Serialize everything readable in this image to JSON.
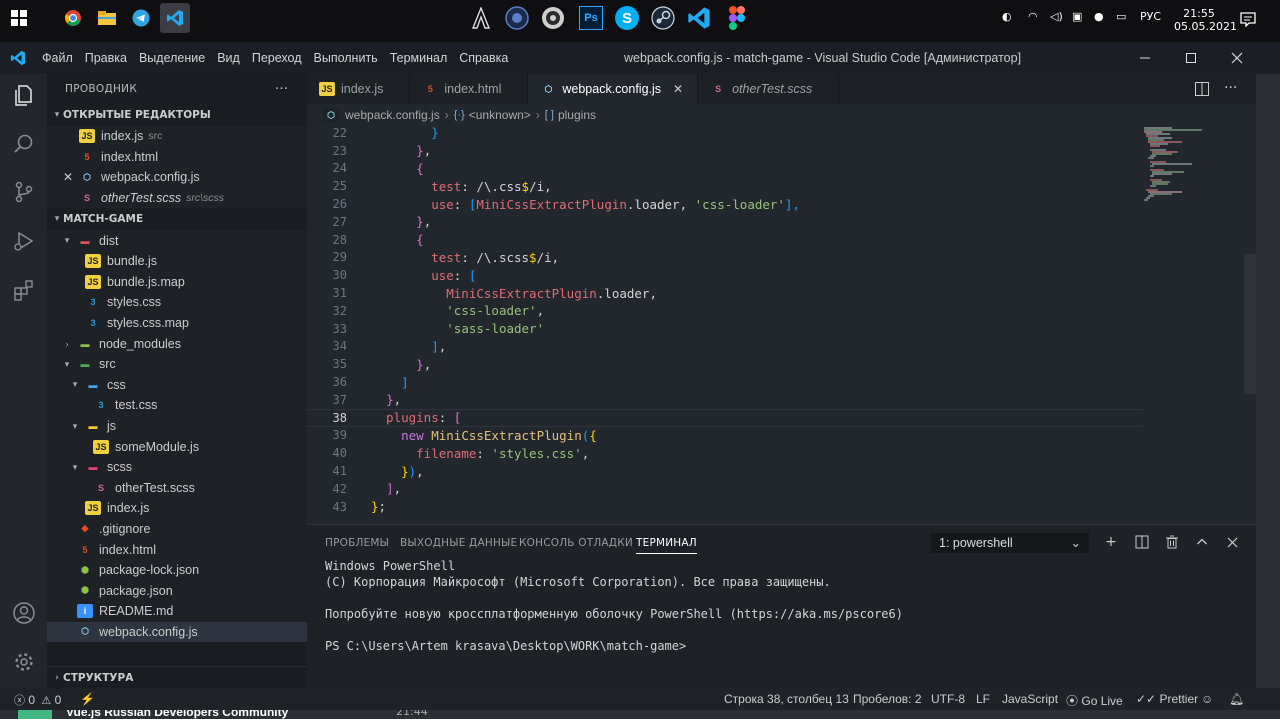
{
  "taskbar": {
    "clock_time": "21:55",
    "clock_date": "05.05.2021",
    "language": "РУС",
    "apps": [
      "windows-start",
      "chrome",
      "file-explorer",
      "telegram",
      "vscode",
      "assassins-creed",
      "cinema4d",
      "obs",
      "photoshop",
      "skype",
      "steam",
      "vscode-pinned",
      "figma"
    ]
  },
  "titlebar": {
    "menu": [
      "Файл",
      "Правка",
      "Выделение",
      "Вид",
      "Переход",
      "Выполнить",
      "Терминал",
      "Справка"
    ],
    "title": "webpack.config.js - match-game - Visual Studio Code [Администратор]"
  },
  "sidebar": {
    "title": "ПРОВОДНИК",
    "more": "···",
    "open_editors_title": "ОТКРЫТЫЕ РЕДАКТОРЫ",
    "open_editors": [
      {
        "name": "index.js",
        "desc": "src",
        "icon": "js"
      },
      {
        "name": "index.html",
        "desc": "",
        "icon": "html"
      },
      {
        "name": "webpack.config.js",
        "desc": "",
        "icon": "webpack",
        "closable": true
      },
      {
        "name": "otherTest.scss",
        "desc": "src\\scss",
        "icon": "scss"
      }
    ],
    "project_title": "MATCH-GAME",
    "tree": [
      {
        "name": "dist",
        "type": "folder",
        "depth": 1,
        "open": true
      },
      {
        "name": "bundle.js",
        "type": "js",
        "depth": 2
      },
      {
        "name": "bundle.js.map",
        "type": "js",
        "depth": 2
      },
      {
        "name": "styles.css",
        "type": "css",
        "depth": 2
      },
      {
        "name": "styles.css.map",
        "type": "css",
        "depth": 2
      },
      {
        "name": "node_modules",
        "type": "folder",
        "depth": 1,
        "open": false
      },
      {
        "name": "src",
        "type": "folder",
        "depth": 1,
        "open": true
      },
      {
        "name": "css",
        "type": "folder",
        "depth": 2,
        "open": true
      },
      {
        "name": "test.css",
        "type": "css",
        "depth": 3
      },
      {
        "name": "js",
        "type": "folder",
        "depth": 2,
        "open": true
      },
      {
        "name": "someModule.js",
        "type": "js",
        "depth": 3
      },
      {
        "name": "scss",
        "type": "folder",
        "depth": 2,
        "open": true
      },
      {
        "name": "otherTest.scss",
        "type": "scss",
        "depth": 3
      },
      {
        "name": "index.js",
        "type": "js",
        "depth": 2
      },
      {
        "name": ".gitignore",
        "type": "git",
        "depth": 1
      },
      {
        "name": "index.html",
        "type": "html",
        "depth": 1
      },
      {
        "name": "package-lock.json",
        "type": "npm",
        "depth": 1
      },
      {
        "name": "package.json",
        "type": "npm",
        "depth": 1
      },
      {
        "name": "README.md",
        "type": "info",
        "depth": 1
      },
      {
        "name": "webpack.config.js",
        "type": "webpack",
        "depth": 1,
        "selected": true
      }
    ],
    "outline_title": "СТРУКТУРА"
  },
  "tabs": [
    {
      "label": "index.js",
      "icon": "js"
    },
    {
      "label": "index.html",
      "icon": "html"
    },
    {
      "label": "webpack.config.js",
      "icon": "webpack",
      "active": true
    },
    {
      "label": "otherTest.scss",
      "icon": "scss",
      "italic": true
    }
  ],
  "breadcrumb": [
    "webpack.config.js",
    "<unknown>",
    "plugins"
  ],
  "editor": {
    "current_line": 38,
    "lines": [
      {
        "n": 22,
        "tokens": [
          [
            "        ",
            "c-punc"
          ],
          [
            "}",
            "c-br3"
          ]
        ]
      },
      {
        "n": 23,
        "tokens": [
          [
            "      ",
            "c-punc"
          ],
          [
            "}",
            "c-br2"
          ],
          [
            ",",
            "c-punc"
          ]
        ]
      },
      {
        "n": 24,
        "tokens": [
          [
            "      ",
            "c-punc"
          ],
          [
            "{",
            "c-br2"
          ]
        ]
      },
      {
        "n": 25,
        "tokens": [
          [
            "        test",
            "c-prop"
          ],
          [
            ": /\\.css",
            "c-re"
          ],
          [
            "$",
            "c-br"
          ],
          [
            "/i,",
            "c-re"
          ]
        ]
      },
      {
        "n": 26,
        "tokens": [
          [
            "        use",
            "c-prop"
          ],
          [
            ": ",
            "c-punc"
          ],
          [
            "[",
            "c-br3"
          ],
          [
            "MiniCssExtractPlugin",
            "c-prop"
          ],
          [
            ".loader, ",
            "c-punc"
          ],
          [
            "'css-loader'",
            "c-str"
          ],
          [
            "],",
            "c-br3"
          ]
        ]
      },
      {
        "n": 27,
        "tokens": [
          [
            "      ",
            "c-punc"
          ],
          [
            "}",
            "c-br2"
          ],
          [
            ",",
            "c-punc"
          ]
        ]
      },
      {
        "n": 28,
        "tokens": [
          [
            "      ",
            "c-punc"
          ],
          [
            "{",
            "c-br2"
          ]
        ]
      },
      {
        "n": 29,
        "tokens": [
          [
            "        test",
            "c-prop"
          ],
          [
            ": /\\.scss",
            "c-re"
          ],
          [
            "$",
            "c-br"
          ],
          [
            "/i,",
            "c-re"
          ]
        ]
      },
      {
        "n": 30,
        "tokens": [
          [
            "        use",
            "c-prop"
          ],
          [
            ": ",
            "c-punc"
          ],
          [
            "[",
            "c-br3"
          ]
        ]
      },
      {
        "n": 31,
        "tokens": [
          [
            "          MiniCssExtractPlugin",
            "c-prop"
          ],
          [
            ".loader,",
            "c-punc"
          ]
        ]
      },
      {
        "n": 32,
        "tokens": [
          [
            "          ",
            "c-punc"
          ],
          [
            "'css-loader'",
            "c-str"
          ],
          [
            ",",
            "c-punc"
          ]
        ]
      },
      {
        "n": 33,
        "tokens": [
          [
            "          ",
            "c-punc"
          ],
          [
            "'sass-loader'",
            "c-str"
          ]
        ]
      },
      {
        "n": 34,
        "tokens": [
          [
            "        ",
            "c-punc"
          ],
          [
            "]",
            "c-br3"
          ],
          [
            ",",
            "c-punc"
          ]
        ]
      },
      {
        "n": 35,
        "tokens": [
          [
            "      ",
            "c-punc"
          ],
          [
            "}",
            "c-br2"
          ],
          [
            ",",
            "c-punc"
          ]
        ]
      },
      {
        "n": 36,
        "tokens": [
          [
            "    ",
            "c-punc"
          ],
          [
            "]",
            "c-br3"
          ]
        ]
      },
      {
        "n": 37,
        "tokens": [
          [
            "  ",
            "c-punc"
          ],
          [
            "}",
            "c-br2"
          ],
          [
            ",",
            "c-punc"
          ]
        ]
      },
      {
        "n": 38,
        "tokens": [
          [
            "  plugins",
            "c-prop"
          ],
          [
            ": ",
            "c-punc"
          ],
          [
            "[",
            "c-br2"
          ]
        ]
      },
      {
        "n": 39,
        "tokens": [
          [
            "    ",
            "c-punc"
          ],
          [
            "new",
            "c-key"
          ],
          [
            " MiniCssExtractPlugin",
            "c-cls"
          ],
          [
            "(",
            "c-br3"
          ],
          [
            "{",
            "c-br"
          ]
        ]
      },
      {
        "n": 40,
        "tokens": [
          [
            "      filename",
            "c-prop"
          ],
          [
            ": ",
            "c-punc"
          ],
          [
            "'styles.css'",
            "c-str"
          ],
          [
            ",",
            "c-punc"
          ]
        ]
      },
      {
        "n": 41,
        "tokens": [
          [
            "    ",
            "c-punc"
          ],
          [
            "}",
            "c-br"
          ],
          [
            ")",
            "c-br3"
          ],
          [
            ",",
            "c-punc"
          ]
        ]
      },
      {
        "n": 42,
        "tokens": [
          [
            "  ",
            "c-punc"
          ],
          [
            "]",
            "c-br2"
          ],
          [
            ",",
            "c-punc"
          ]
        ]
      },
      {
        "n": 43,
        "tokens": [
          [
            "}",
            "c-br"
          ],
          [
            ";",
            "c-punc"
          ]
        ]
      }
    ]
  },
  "panel": {
    "tabs": [
      "ПРОБЛЕМЫ",
      "ВЫХОДНЫЕ ДАННЫЕ",
      "КОНСОЛЬ ОТЛАДКИ",
      "ТЕРМИНАЛ"
    ],
    "active_tab": "ТЕРМИНАЛ",
    "terminal_select": "1: powershell",
    "terminal_lines": [
      "Windows PowerShell",
      "(C) Корпорация Майкрософт (Microsoft Corporation). Все права защищены.",
      "",
      "Попробуйте новую кроссплатформенную оболочку PowerShell (https://aka.ms/pscore6)",
      "",
      "PS C:\\Users\\Artem krasava\\Desktop\\WORK\\match-game>"
    ]
  },
  "statusbar": {
    "errors": "0",
    "warnings": "0",
    "position": "Строка 38, столбец 13",
    "spaces": "Пробелов: 2",
    "encoding": "UTF-8",
    "eol": "LF",
    "language": "JavaScript",
    "golive": "Go Live",
    "prettier": "Prettier"
  },
  "bottom_overlay": {
    "text": "Vue.js Russian Developers Community",
    "time": "21:44"
  },
  "colors": {
    "accent_vscode": "#23a9f2",
    "js_icon": "#f0d040",
    "html_icon": "#e44d26",
    "css_icon": "#2a9fd6",
    "scss_icon": "#cd6799",
    "webpack_icon": "#8ed6fb"
  }
}
